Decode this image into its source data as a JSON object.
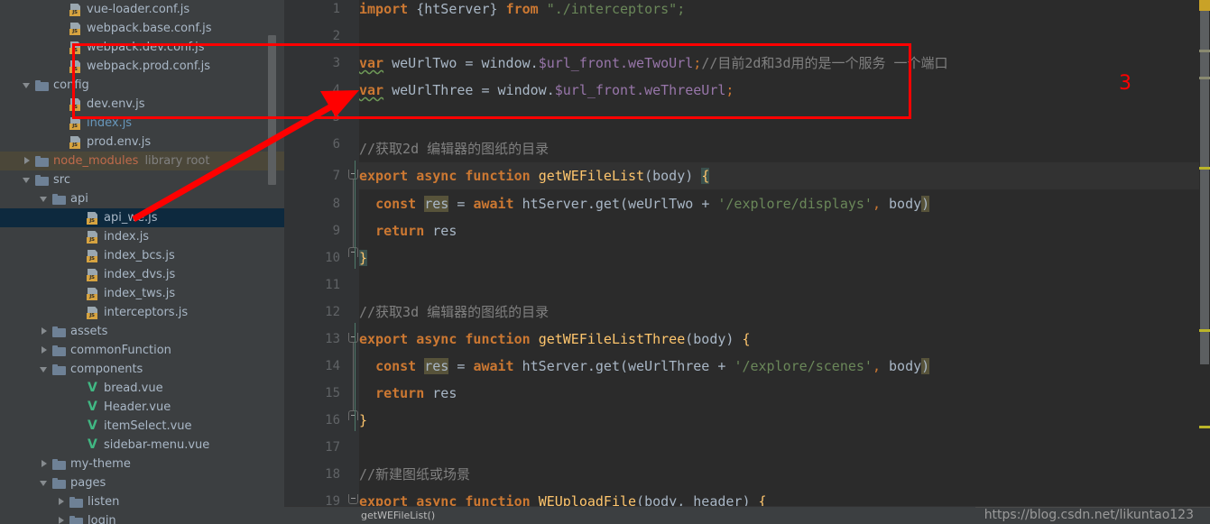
{
  "app": {
    "theme_accent": "#cc7832",
    "background": "#2b2b2b",
    "sidebar_background": "#3c3f41",
    "selection_color": "#0d293e",
    "annotation_color": "#ff0000"
  },
  "sidebar": {
    "items": [
      {
        "indent": 3,
        "twisty": "none",
        "icon": "js-file-icon",
        "label": "vue-loader.conf.js",
        "color": "default",
        "hint": "",
        "state": "normal"
      },
      {
        "indent": 3,
        "twisty": "none",
        "icon": "js-file-icon",
        "label": "webpack.base.conf.js",
        "color": "default",
        "hint": "",
        "state": "normal"
      },
      {
        "indent": 3,
        "twisty": "none",
        "icon": "js-file-icon",
        "label": "webpack.dev.conf.js",
        "color": "default",
        "hint": "",
        "state": "normal"
      },
      {
        "indent": 3,
        "twisty": "none",
        "icon": "js-file-icon",
        "label": "webpack.prod.conf.js",
        "color": "default",
        "hint": "",
        "state": "normal"
      },
      {
        "indent": 1,
        "twisty": "open",
        "icon": "folder-icon",
        "label": "config",
        "color": "default",
        "hint": "",
        "state": "normal"
      },
      {
        "indent": 3,
        "twisty": "none",
        "icon": "js-file-icon",
        "label": "dev.env.js",
        "color": "default",
        "hint": "",
        "state": "normal"
      },
      {
        "indent": 3,
        "twisty": "none",
        "icon": "js-file-icon",
        "label": "index.js",
        "color": "blue",
        "hint": "",
        "state": "normal"
      },
      {
        "indent": 3,
        "twisty": "none",
        "icon": "js-file-icon",
        "label": "prod.env.js",
        "color": "default",
        "hint": "",
        "state": "normal"
      },
      {
        "indent": 1,
        "twisty": "closed",
        "icon": "folder-icon",
        "label": "node_modules",
        "color": "orange",
        "hint": "library root",
        "state": "library-root"
      },
      {
        "indent": 1,
        "twisty": "open",
        "icon": "folder-icon",
        "label": "src",
        "color": "default",
        "hint": "",
        "state": "normal"
      },
      {
        "indent": 2,
        "twisty": "open",
        "icon": "folder-icon",
        "label": "api",
        "color": "default",
        "hint": "",
        "state": "normal"
      },
      {
        "indent": 4,
        "twisty": "none",
        "icon": "js-file-icon",
        "label": "api_we.js",
        "color": "default",
        "hint": "",
        "state": "selected"
      },
      {
        "indent": 4,
        "twisty": "none",
        "icon": "js-file-icon",
        "label": "index.js",
        "color": "default",
        "hint": "",
        "state": "normal"
      },
      {
        "indent": 4,
        "twisty": "none",
        "icon": "js-file-icon",
        "label": "index_bcs.js",
        "color": "default",
        "hint": "",
        "state": "normal"
      },
      {
        "indent": 4,
        "twisty": "none",
        "icon": "js-file-icon",
        "label": "index_dvs.js",
        "color": "default",
        "hint": "",
        "state": "normal"
      },
      {
        "indent": 4,
        "twisty": "none",
        "icon": "js-file-icon",
        "label": "index_tws.js",
        "color": "default",
        "hint": "",
        "state": "normal"
      },
      {
        "indent": 4,
        "twisty": "none",
        "icon": "js-file-icon",
        "label": "interceptors.js",
        "color": "default",
        "hint": "",
        "state": "normal"
      },
      {
        "indent": 2,
        "twisty": "closed",
        "icon": "folder-icon",
        "label": "assets",
        "color": "default",
        "hint": "",
        "state": "normal"
      },
      {
        "indent": 2,
        "twisty": "closed",
        "icon": "folder-icon",
        "label": "commonFunction",
        "color": "default",
        "hint": "",
        "state": "normal"
      },
      {
        "indent": 2,
        "twisty": "open",
        "icon": "folder-icon",
        "label": "components",
        "color": "default",
        "hint": "",
        "state": "normal"
      },
      {
        "indent": 4,
        "twisty": "none",
        "icon": "vue-file-icon",
        "label": "bread.vue",
        "color": "default",
        "hint": "",
        "state": "normal"
      },
      {
        "indent": 4,
        "twisty": "none",
        "icon": "vue-file-icon",
        "label": "Header.vue",
        "color": "default",
        "hint": "",
        "state": "normal"
      },
      {
        "indent": 4,
        "twisty": "none",
        "icon": "vue-file-icon",
        "label": "itemSelect.vue",
        "color": "default",
        "hint": "",
        "state": "normal"
      },
      {
        "indent": 4,
        "twisty": "none",
        "icon": "vue-file-icon",
        "label": "sidebar-menu.vue",
        "color": "default",
        "hint": "",
        "state": "normal"
      },
      {
        "indent": 2,
        "twisty": "closed",
        "icon": "folder-icon",
        "label": "my-theme",
        "color": "default",
        "hint": "",
        "state": "normal"
      },
      {
        "indent": 2,
        "twisty": "open",
        "icon": "folder-icon",
        "label": "pages",
        "color": "default",
        "hint": "",
        "state": "normal"
      },
      {
        "indent": 3,
        "twisty": "closed",
        "icon": "folder-icon",
        "label": "listen",
        "color": "default",
        "hint": "",
        "state": "normal"
      },
      {
        "indent": 3,
        "twisty": "closed",
        "icon": "folder-icon",
        "label": "login",
        "color": "default",
        "hint": "",
        "state": "normal"
      }
    ]
  },
  "editor": {
    "file": "api_we.js",
    "line_numbers": [
      "1",
      "2",
      "3",
      "4",
      "5",
      "6",
      "7",
      "8",
      "9",
      "10",
      "11",
      "12",
      "13",
      "14",
      "15",
      "16",
      "17",
      "18",
      "19"
    ],
    "lines": [
      {
        "no": "1",
        "text": "import {htServer} from \"./interceptors\";"
      },
      {
        "no": "2",
        "text": ""
      },
      {
        "no": "3",
        "text": "var weUrlTwo = window.$url_front.weTwoUrl;//目前2d和3d用的是一个服务 一个端口"
      },
      {
        "no": "4",
        "text": "var weUrlThree = window.$url_front.weThreeUrl;"
      },
      {
        "no": "5",
        "text": ""
      },
      {
        "no": "6",
        "text": "//获取2d 编辑器的图纸的目录"
      },
      {
        "no": "7",
        "text": "export async function getWEFileList(body) {"
      },
      {
        "no": "8",
        "text": "  const res = await htServer.get(weUrlTwo + '/explore/displays', body)"
      },
      {
        "no": "9",
        "text": "  return res"
      },
      {
        "no": "10",
        "text": "}"
      },
      {
        "no": "11",
        "text": ""
      },
      {
        "no": "12",
        "text": "//获取3d 编辑器的图纸的目录"
      },
      {
        "no": "13",
        "text": "export async function getWEFileListThree(body) {"
      },
      {
        "no": "14",
        "text": "  const res = await htServer.get(weUrlThree + '/explore/scenes', body)"
      },
      {
        "no": "15",
        "text": "  return res"
      },
      {
        "no": "16",
        "text": "}"
      },
      {
        "no": "17",
        "text": ""
      },
      {
        "no": "18",
        "text": "//新建图纸或场景"
      },
      {
        "no": "19",
        "text": "export async function WEUploadFile(body, header) {"
      }
    ],
    "tokens": {
      "kw_import": "import",
      "kw_from": "from",
      "kw_var": "var",
      "kw_export": "export",
      "kw_async": "async",
      "kw_function": "function",
      "kw_const": "const",
      "kw_await": "await",
      "kw_return": "return",
      "brace_htserver": "{htServer}",
      "str_interceptors": "\"./interceptors\";",
      "id_weUrlTwo": "weUrlTwo",
      "id_weUrlThree": "weUrlThree",
      "id_window": "window.",
      "fld_urlfront": "$url_front",
      "fld_weTwoUrl": ".weTwoUrl",
      "fld_weThreeUrl": ".weThreeUrl",
      "semi": ";",
      "comment_line3": "//目前2d和3d用的是一个服务 一个端口",
      "comment_line6": "//获取2d 编辑器的图纸的目录",
      "comment_line12": "//获取3d 编辑器的图纸的目录",
      "comment_line18": "//新建图纸或场景",
      "fn_getWEFileList": "getWEFileList",
      "fn_getWEFileListThree": "getWEFileListThree",
      "fn_WEUploadFile": "WEUploadFile",
      "param_body": "(body)",
      "param_body_header": "(body, header)",
      "brace_open": "{",
      "brace_close": "}",
      "id_res": "res",
      "eq": "=",
      "id_htServer_get": "htServer.get(",
      "plus": "+",
      "str_displays": "'/explore/displays'",
      "str_scenes": "'/explore/scenes'",
      "comma": ",",
      "id_body": "body",
      "paren_close": ")"
    }
  },
  "annotation": {
    "number_label": "3",
    "box_color": "#ff0000",
    "arrow_from": "api_we.js tree node",
    "arrow_to": "highlighted var declarations"
  },
  "breadcrumb": {
    "text": "getWEFileList()"
  },
  "watermark": {
    "text": "https://blog.csdn.net/likuntao123"
  }
}
